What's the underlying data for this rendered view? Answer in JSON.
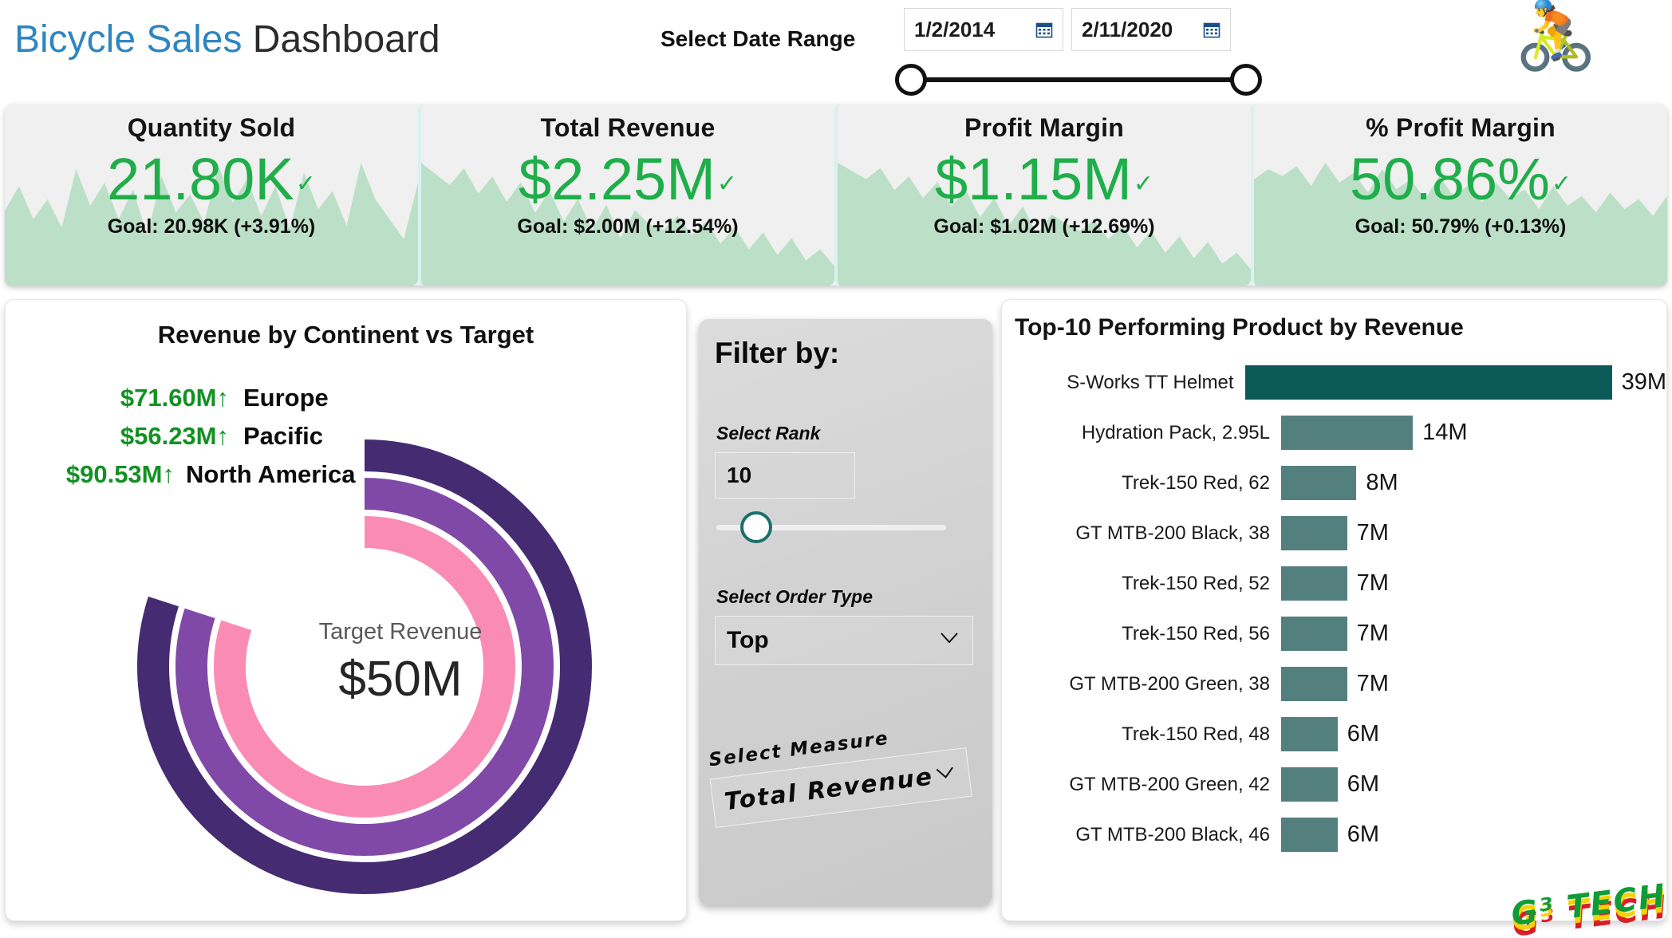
{
  "header": {
    "title_part1": "Bicycle Sales",
    "title_part2": " Dashboard",
    "date_range_label": "Select Date Range",
    "date_start": "1/2/2014",
    "date_end": "2/11/2020",
    "calendar_icon": "calendar-icon",
    "bike_icon": "🚴",
    "slider_min_handle": "range-slider-start-handle",
    "slider_max_handle": "range-slider-end-handle"
  },
  "kpis": [
    {
      "title": "Quantity Sold",
      "value": "21.80K",
      "check": "✓",
      "goal": "Goal: 20.98K (+3.91%)",
      "spark": "45,60,40,52,35,70,48,62,40,58,30,66,44,55,38,72,50,64,42,60,34,68,46,57,36,74,52,40,28,62"
    },
    {
      "title": "Total Revenue",
      "value": "$2.25M",
      "check": "✓",
      "goal": "Goal: $2.00M (+12.54%)",
      "spark": "88,80,72,84,66,78,60,74,52,68,46,62,40,58,34,54,44,40,50,36,46,30,42,26,38,22,34,18,26,14"
    },
    {
      "title": "Profit Margin",
      "value": "$1.15M",
      "check": "✓",
      "goal": "Goal: $1.02M (+12.69%)",
      "spark": "90,84,78,86,70,80,64,76,58,70,50,64,44,58,38,52,46,40,48,34,44,28,40,24,36,20,32,16,24,12"
    },
    {
      "title": "% Profit Margin",
      "value": "50.86%",
      "check": "✓",
      "goal": "Goal: 50.79% (+0.13%)",
      "spark": "64,70,66,72,60,74,62,68,56,70,58,64,52,66,54,60,50,62,52,58,46,60,48,54,44,56,46,52,42,54"
    }
  ],
  "radial": {
    "title": "Revenue by Continent vs Target",
    "center_label": "Target Revenue",
    "center_value": "$50M",
    "arrow": "↑",
    "legend": [
      {
        "value": "$71.60M",
        "name": "Europe",
        "color": "#452B72"
      },
      {
        "value": "$56.23M",
        "name": "Pacific",
        "color": "#8049A8"
      },
      {
        "value": "$90.53M",
        "name": "North America",
        "color": "#FA8CB4"
      }
    ]
  },
  "filter": {
    "title": "Filter by:",
    "rank_label": "Select Rank",
    "rank_value": "10",
    "order_type_label": "Select Order Type",
    "order_type_value": "Top",
    "measure_label": "Select Measure",
    "measure_value": "Total Revenue",
    "chevron_icon": "chevron-down-icon"
  },
  "bars_title": "Top-10 Performing Product by Revenue",
  "watermark": "G³ TECH",
  "chart_data": [
    {
      "type": "bar",
      "title": "Top-10 Performing Product by Revenue",
      "xlabel": "Revenue",
      "ylabel": "",
      "orientation": "horizontal",
      "categories": [
        "S-Works TT Helmet",
        "Hydration Pack, 2.95L",
        "Trek-150 Red, 62",
        "GT MTB-200 Black, 38",
        "Trek-150 Red, 52",
        "Trek-150 Red, 56",
        "GT MTB-200 Green, 38",
        "Trek-150 Red, 48",
        "GT MTB-200 Green, 42",
        "GT MTB-200 Black, 46"
      ],
      "values": [
        39,
        14,
        8,
        7,
        7,
        7,
        7,
        6,
        6,
        6
      ],
      "labels": [
        "39M",
        "14M",
        "8M",
        "7M",
        "7M",
        "7M",
        "7M",
        "6M",
        "6M",
        "6M"
      ],
      "colors": [
        "#0C5A58",
        "#53807F",
        "#53807F",
        "#53807F",
        "#53807F",
        "#53807F",
        "#53807F",
        "#53807F",
        "#53807F",
        "#53807F"
      ],
      "xlim": [
        0,
        39
      ],
      "grid": false,
      "legend": "none"
    },
    {
      "type": "pie",
      "subtype": "radial-bar",
      "title": "Revenue by Continent vs Target",
      "center_label": "Target Revenue",
      "center_value_text": "$50M",
      "target": 50,
      "categories": [
        "Europe",
        "Pacific",
        "North America"
      ],
      "values": [
        71.6,
        56.23,
        90.53
      ],
      "value_labels": [
        "$71.60M",
        "$56.23M",
        "$90.53M"
      ],
      "colors": [
        "#452B72",
        "#8049A8",
        "#FA8CB4"
      ],
      "sweep_fraction": [
        0.8,
        0.8,
        0.8
      ],
      "legend": "left"
    },
    {
      "type": "area",
      "title": "KPI sparklines",
      "series": [
        {
          "name": "Quantity Sold",
          "value": 21.8,
          "goal": 20.98,
          "delta_pct": 3.91
        },
        {
          "name": "Total Revenue",
          "value": 2.25,
          "goal": 2.0,
          "delta_pct": 12.54
        },
        {
          "name": "Profit Margin",
          "value": 1.15,
          "goal": 1.02,
          "delta_pct": 12.69
        },
        {
          "name": "% Profit Margin",
          "value": 50.86,
          "goal": 50.79,
          "delta_pct": 0.13
        }
      ],
      "color": "#BCE0C7"
    }
  ]
}
